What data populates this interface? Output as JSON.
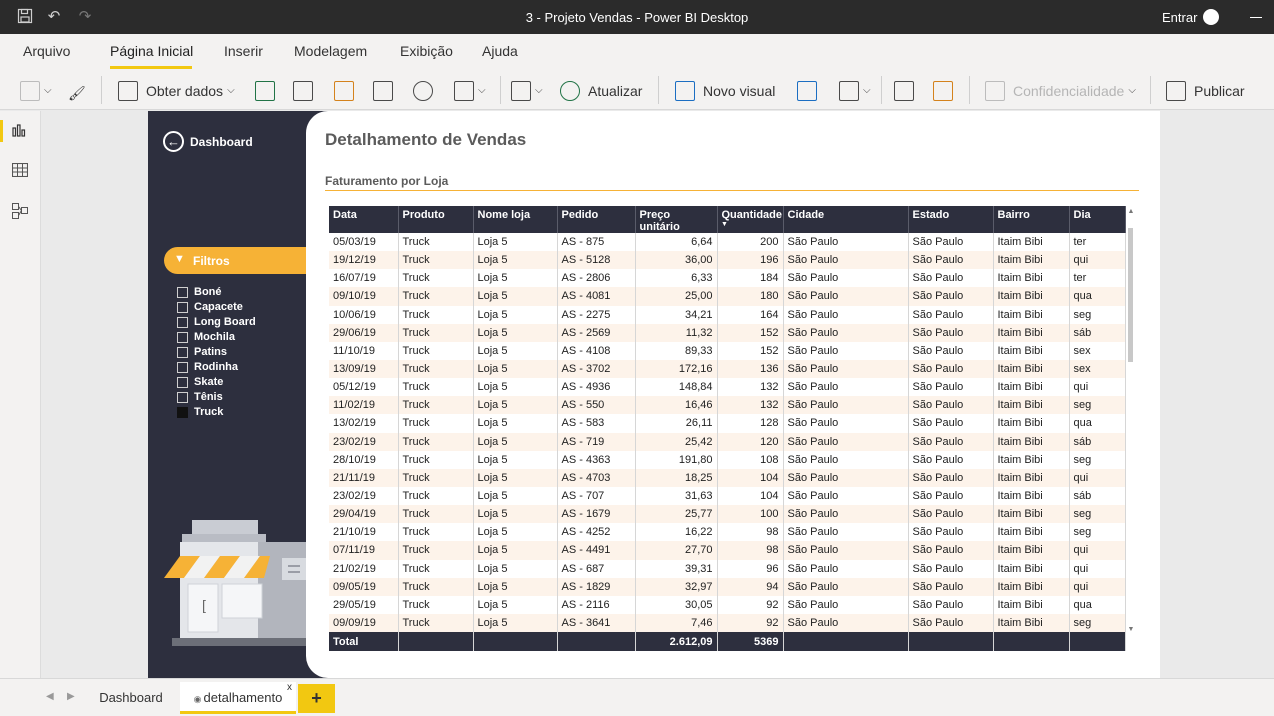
{
  "window": {
    "title": "3 - Projeto Vendas - Power BI Desktop",
    "sign_in": "Entrar"
  },
  "menu": {
    "items": [
      "Arquivo",
      "Página Inicial",
      "Inserir",
      "Modelagem",
      "Exibição",
      "Ajuda"
    ],
    "active": "Página Inicial"
  },
  "ribbon": {
    "get_data": "Obter dados",
    "refresh": "Atualizar",
    "new_visual": "Novo visual",
    "sensitivity": "Confidencialidade",
    "publish": "Publicar"
  },
  "report": {
    "back_label": "Dashboard",
    "filter_title": "Filtros",
    "filters": [
      {
        "label": "Boné",
        "checked": false
      },
      {
        "label": "Capacete",
        "checked": false
      },
      {
        "label": "Long Board",
        "checked": false
      },
      {
        "label": "Mochila",
        "checked": false
      },
      {
        "label": "Patins",
        "checked": false
      },
      {
        "label": "Rodinha",
        "checked": false
      },
      {
        "label": "Skate",
        "checked": false
      },
      {
        "label": "Tênis",
        "checked": false
      },
      {
        "label": "Truck",
        "checked": true
      }
    ],
    "page_title": "Detalhamento de Vendas",
    "section_title": "Faturamento por Loja"
  },
  "table": {
    "headers": [
      "Data",
      "Produto",
      "Nome loja",
      "Pedido",
      "Preço unitário",
      "Quantidade",
      "Cidade",
      "Estado",
      "Bairro",
      "Dia"
    ],
    "sorted_column": "Quantidade",
    "rows": [
      [
        "05/03/19",
        "Truck",
        "Loja 5",
        "AS - 875",
        "6,64",
        "200",
        "São Paulo",
        "São Paulo",
        "Itaim Bibi",
        "ter"
      ],
      [
        "19/12/19",
        "Truck",
        "Loja 5",
        "AS - 5128",
        "36,00",
        "196",
        "São Paulo",
        "São Paulo",
        "Itaim Bibi",
        "qui"
      ],
      [
        "16/07/19",
        "Truck",
        "Loja 5",
        "AS - 2806",
        "6,33",
        "184",
        "São Paulo",
        "São Paulo",
        "Itaim Bibi",
        "ter"
      ],
      [
        "09/10/19",
        "Truck",
        "Loja 5",
        "AS - 4081",
        "25,00",
        "180",
        "São Paulo",
        "São Paulo",
        "Itaim Bibi",
        "qua"
      ],
      [
        "10/06/19",
        "Truck",
        "Loja 5",
        "AS - 2275",
        "34,21",
        "164",
        "São Paulo",
        "São Paulo",
        "Itaim Bibi",
        "seg"
      ],
      [
        "29/06/19",
        "Truck",
        "Loja 5",
        "AS - 2569",
        "11,32",
        "152",
        "São Paulo",
        "São Paulo",
        "Itaim Bibi",
        "sáb"
      ],
      [
        "11/10/19",
        "Truck",
        "Loja 5",
        "AS - 4108",
        "89,33",
        "152",
        "São Paulo",
        "São Paulo",
        "Itaim Bibi",
        "sex"
      ],
      [
        "13/09/19",
        "Truck",
        "Loja 5",
        "AS - 3702",
        "172,16",
        "136",
        "São Paulo",
        "São Paulo",
        "Itaim Bibi",
        "sex"
      ],
      [
        "05/12/19",
        "Truck",
        "Loja 5",
        "AS - 4936",
        "148,84",
        "132",
        "São Paulo",
        "São Paulo",
        "Itaim Bibi",
        "qui"
      ],
      [
        "11/02/19",
        "Truck",
        "Loja 5",
        "AS - 550",
        "16,46",
        "132",
        "São Paulo",
        "São Paulo",
        "Itaim Bibi",
        "seg"
      ],
      [
        "13/02/19",
        "Truck",
        "Loja 5",
        "AS - 583",
        "26,11",
        "128",
        "São Paulo",
        "São Paulo",
        "Itaim Bibi",
        "qua"
      ],
      [
        "23/02/19",
        "Truck",
        "Loja 5",
        "AS - 719",
        "25,42",
        "120",
        "São Paulo",
        "São Paulo",
        "Itaim Bibi",
        "sáb"
      ],
      [
        "28/10/19",
        "Truck",
        "Loja 5",
        "AS - 4363",
        "191,80",
        "108",
        "São Paulo",
        "São Paulo",
        "Itaim Bibi",
        "seg"
      ],
      [
        "21/11/19",
        "Truck",
        "Loja 5",
        "AS - 4703",
        "18,25",
        "104",
        "São Paulo",
        "São Paulo",
        "Itaim Bibi",
        "qui"
      ],
      [
        "23/02/19",
        "Truck",
        "Loja 5",
        "AS - 707",
        "31,63",
        "104",
        "São Paulo",
        "São Paulo",
        "Itaim Bibi",
        "sáb"
      ],
      [
        "29/04/19",
        "Truck",
        "Loja 5",
        "AS - 1679",
        "25,77",
        "100",
        "São Paulo",
        "São Paulo",
        "Itaim Bibi",
        "seg"
      ],
      [
        "21/10/19",
        "Truck",
        "Loja 5",
        "AS - 4252",
        "16,22",
        "98",
        "São Paulo",
        "São Paulo",
        "Itaim Bibi",
        "seg"
      ],
      [
        "07/11/19",
        "Truck",
        "Loja 5",
        "AS - 4491",
        "27,70",
        "98",
        "São Paulo",
        "São Paulo",
        "Itaim Bibi",
        "qui"
      ],
      [
        "21/02/19",
        "Truck",
        "Loja 5",
        "AS - 687",
        "39,31",
        "96",
        "São Paulo",
        "São Paulo",
        "Itaim Bibi",
        "qui"
      ],
      [
        "09/05/19",
        "Truck",
        "Loja 5",
        "AS - 1829",
        "32,97",
        "94",
        "São Paulo",
        "São Paulo",
        "Itaim Bibi",
        "qui"
      ],
      [
        "29/05/19",
        "Truck",
        "Loja 5",
        "AS - 2116",
        "30,05",
        "92",
        "São Paulo",
        "São Paulo",
        "Itaim Bibi",
        "qua"
      ],
      [
        "09/09/19",
        "Truck",
        "Loja 5",
        "AS - 3641",
        "7,46",
        "92",
        "São Paulo",
        "São Paulo",
        "Itaim Bibi",
        "seg"
      ]
    ],
    "total": [
      "Total",
      "",
      "",
      "",
      "2.612,09",
      "5369",
      "",
      "",
      "",
      ""
    ]
  },
  "pages": {
    "tabs": [
      "Dashboard",
      "detalhamento"
    ],
    "active": "detalhamento"
  },
  "colors": {
    "accent": "#f2c811",
    "dark": "#2d2f3e",
    "orange": "#f6b236"
  }
}
